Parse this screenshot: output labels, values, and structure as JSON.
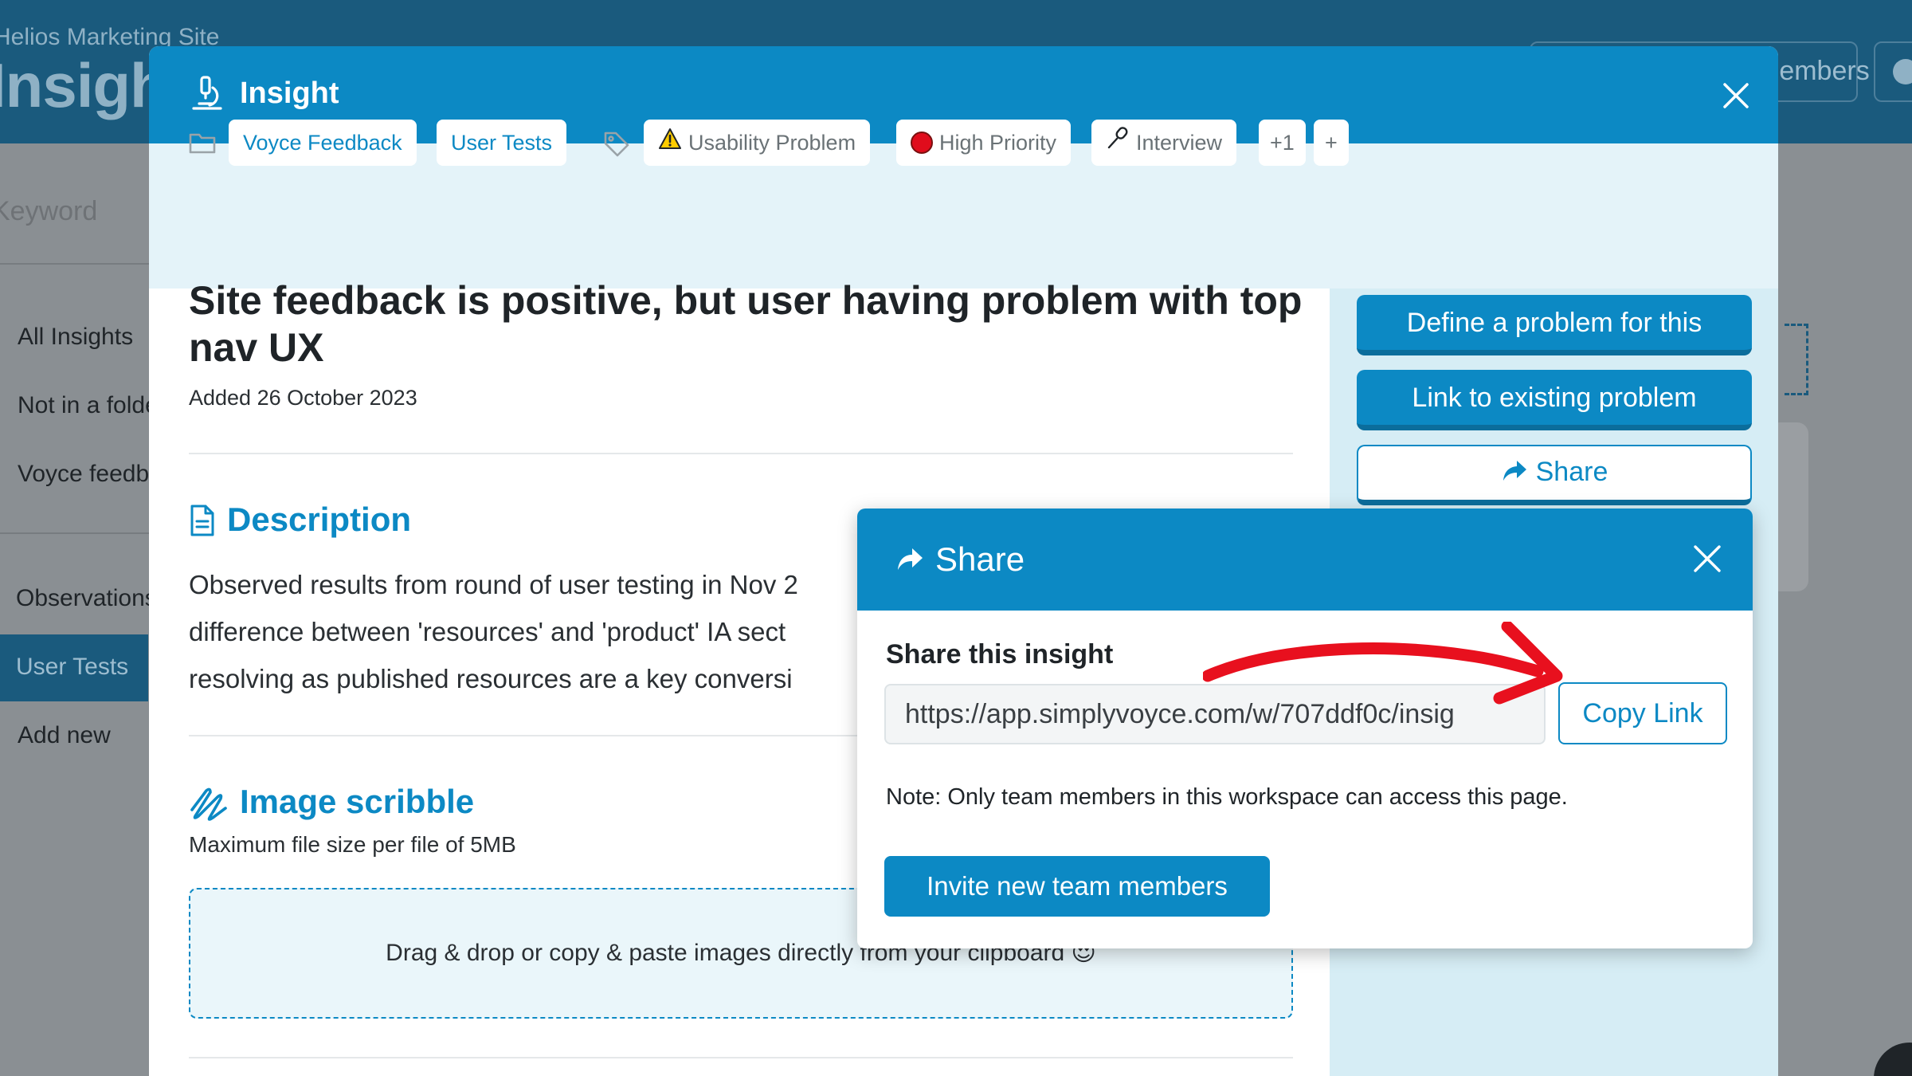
{
  "background": {
    "workspace": "Helios Marketing Site",
    "page_title": "Insights",
    "members_button": "Members",
    "search_placeholder": "Keyword",
    "nav": [
      "All Insights",
      "Not in a folder",
      "Voyce feedback",
      "Observations",
      "User Tests",
      "Add new"
    ]
  },
  "modal": {
    "title": "Insight",
    "folders": [
      "Voyce Feedback",
      "User Tests"
    ],
    "tags": [
      {
        "label": "Usability Problem",
        "icon": "warning-icon"
      },
      {
        "label": "High Priority",
        "icon": "red-circle-icon"
      },
      {
        "label": "Interview",
        "icon": "microphone-icon"
      }
    ],
    "more_tags": "+1",
    "add_tag": "+",
    "insight_title": "Site feedback is positive, but user having problem with top nav UX",
    "added_date": "Added 26 October 2023",
    "description": {
      "heading": "Description",
      "lines": [
        "Observed results from round of user testing in Nov 2",
        "difference between 'resources' and 'product' IA sect",
        "resolving as published resources are a key conversi"
      ]
    },
    "scribble": {
      "heading": "Image scribble",
      "subtitle": "Maximum file size per file of 5MB",
      "dropzone": "Drag & drop or copy & paste images directly from your clipboard 😍"
    },
    "actions": {
      "define_problem": "Define a problem for this",
      "link_problem": "Link to existing problem",
      "share": "Share"
    }
  },
  "share_popup": {
    "title": "Share",
    "label": "Share this insight",
    "url": "https://app.simplyvoyce.com/w/707ddf0c/insig",
    "copy_button": "Copy Link",
    "note": "Note: Only team members in this workspace can access this page.",
    "invite_button": "Invite new team members"
  },
  "colors": {
    "primary": "#0c89c4",
    "annotation_arrow": "#e8101e",
    "panel_bg": "#d6edf5",
    "tagbar_bg": "#e4f3f9"
  }
}
